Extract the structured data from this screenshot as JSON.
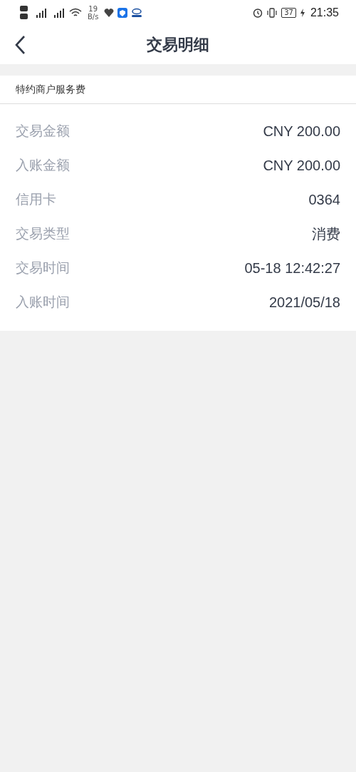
{
  "status_bar": {
    "net_speed": "19",
    "net_unit": "B/s",
    "battery": "37",
    "time": "21:35"
  },
  "header": {
    "title": "交易明细"
  },
  "merchant": "特约商户服务费",
  "details": [
    {
      "label": "交易金额",
      "value": "CNY 200.00"
    },
    {
      "label": "入账金额",
      "value": "CNY 200.00"
    },
    {
      "label": "信用卡",
      "value": "0364"
    },
    {
      "label": "交易类型",
      "value": "消费"
    },
    {
      "label": "交易时间",
      "value": "05-18 12:42:27"
    },
    {
      "label": "入账时间",
      "value": "2021/05/18"
    }
  ]
}
